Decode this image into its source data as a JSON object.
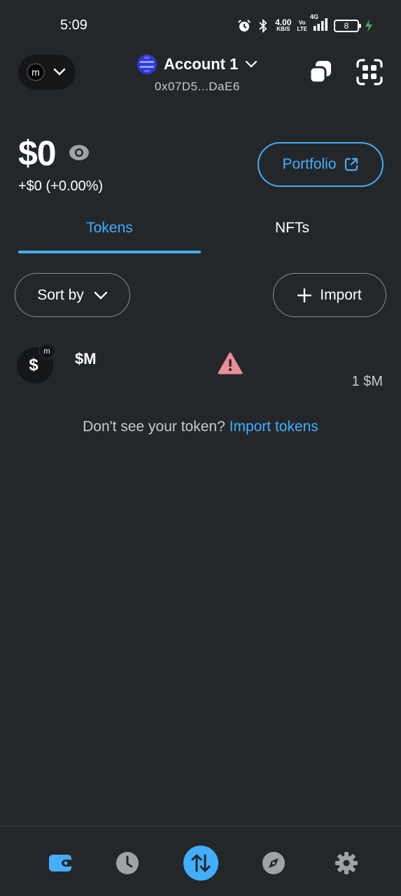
{
  "status_bar": {
    "time": "5:09",
    "speed_value": "4.00",
    "speed_unit": "KB/S",
    "volte_top": "Vo",
    "volte_bottom": "LTE",
    "network_gen": "4G",
    "battery_level": "8"
  },
  "header": {
    "network_avatar_letter": "m",
    "account_name": "Account 1",
    "account_address": "0x07D5...DaE6"
  },
  "balance": {
    "amount": "$0",
    "change": "+$0 (+0.00%)",
    "portfolio_label": "Portfolio"
  },
  "tabs": [
    {
      "label": "Tokens",
      "active": true
    },
    {
      "label": "NFTs",
      "active": false
    }
  ],
  "controls": {
    "sort_label": "Sort by",
    "import_label": "Import"
  },
  "tokens": [
    {
      "icon_symbol": "$",
      "badge_letter": "m",
      "name": "$M",
      "balance": "1 $M",
      "warning": true
    }
  ],
  "import_prompt": {
    "text": "Don't see your token?",
    "link": "Import tokens"
  },
  "bottom_nav": {
    "items": [
      "wallet-icon",
      "clock-icon",
      "swap-icon",
      "compass-icon",
      "gear-icon"
    ],
    "active": "wallet-icon"
  },
  "colors": {
    "background": "#24272a",
    "accent": "#43aefc",
    "warning": "#e88f97",
    "muted_icon": "#9fa2a6"
  }
}
